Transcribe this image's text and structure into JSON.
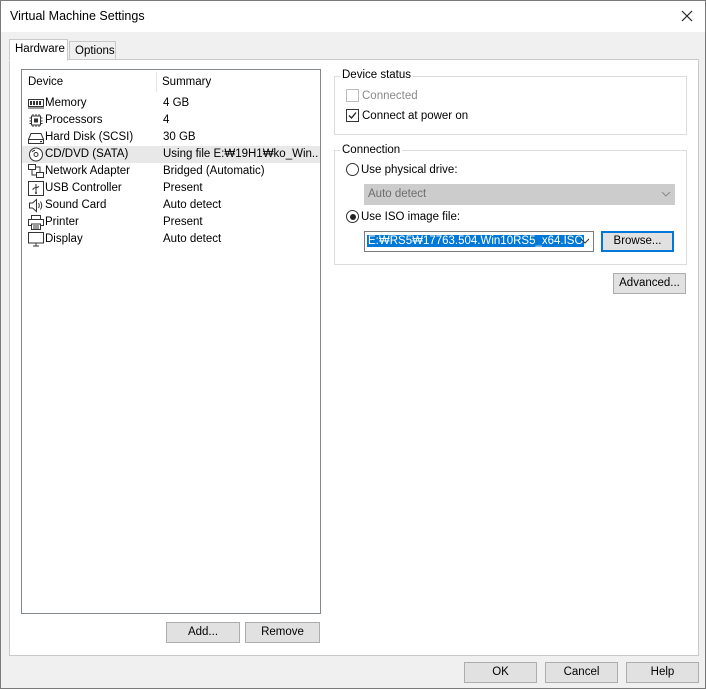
{
  "window": {
    "title": "Virtual Machine Settings"
  },
  "tabs": [
    {
      "label": "Hardware",
      "active": true
    },
    {
      "label": "Options",
      "active": false
    }
  ],
  "device_list": {
    "columns": {
      "device": "Device",
      "summary": "Summary"
    },
    "items": [
      {
        "name": "Memory",
        "summary": "4 GB",
        "icon": "memory-icon"
      },
      {
        "name": "Processors",
        "summary": "4",
        "icon": "processor-icon"
      },
      {
        "name": "Hard Disk (SCSI)",
        "summary": "30 GB",
        "icon": "hard-disk-icon"
      },
      {
        "name": "CD/DVD (SATA)",
        "summary": "Using file E:₩19H1₩ko_Win...",
        "icon": "cd-dvd-icon",
        "selected": true
      },
      {
        "name": "Network Adapter",
        "summary": "Bridged (Automatic)",
        "icon": "network-adapter-icon"
      },
      {
        "name": "USB Controller",
        "summary": "Present",
        "icon": "usb-icon"
      },
      {
        "name": "Sound Card",
        "summary": "Auto detect",
        "icon": "speaker-icon"
      },
      {
        "name": "Printer",
        "summary": "Present",
        "icon": "printer-icon"
      },
      {
        "name": "Display",
        "summary": "Auto detect",
        "icon": "monitor-icon"
      }
    ]
  },
  "list_buttons": {
    "add": "Add...",
    "remove": "Remove"
  },
  "device_status": {
    "title": "Device status",
    "connected": {
      "label": "Connected",
      "checked": false,
      "enabled": false
    },
    "connect_at_power_on": {
      "label": "Connect at power on",
      "checked": true
    }
  },
  "connection": {
    "title": "Connection",
    "physical_drive": {
      "label": "Use physical drive:",
      "selected": false
    },
    "physical_drive_value": "Auto detect",
    "iso": {
      "label": "Use ISO image file:",
      "selected": true
    },
    "iso_path": "E:₩RS5₩17763.504.Win10RS5_x64.ISO",
    "browse": "Browse..."
  },
  "advanced_button": "Advanced...",
  "footer": {
    "ok": "OK",
    "cancel": "Cancel",
    "help": "Help"
  },
  "colors": {
    "accent": "#0078d7",
    "selection_bg": "#e8e8e8"
  }
}
